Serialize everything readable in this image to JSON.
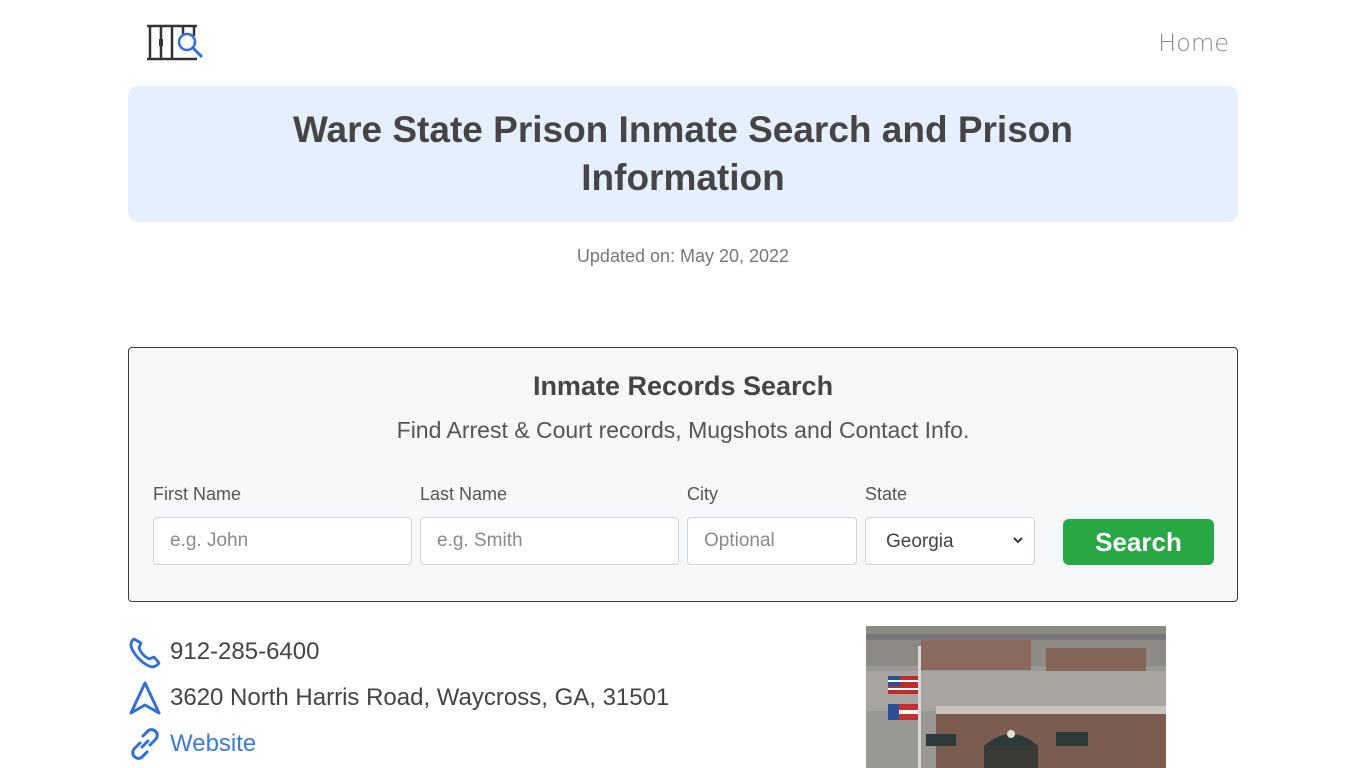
{
  "header": {
    "logo_icon": "jail-bars-search-icon",
    "nav_home": "Home"
  },
  "hero": {
    "title": "Ware State Prison Inmate Search and Prison Information"
  },
  "updated": "Updated on: May 20, 2022",
  "search": {
    "title": "Inmate Records Search",
    "subtitle": "Find Arrest & Court records, Mugshots and Contact Info.",
    "first_name_label": "First Name",
    "first_name_placeholder": "e.g. John",
    "last_name_label": "Last Name",
    "last_name_placeholder": "e.g. Smith",
    "city_label": "City",
    "city_placeholder": "Optional",
    "state_label": "State",
    "state_value": "Georgia",
    "button_label": "Search",
    "button_color": "#27a844"
  },
  "contact": {
    "phone": "912-285-6400",
    "address": "3620 North Harris Road, Waycross, GA, 31501",
    "website_label": "Website",
    "icon_color": "#2f6fdc"
  },
  "photo": {
    "subject": "prison-building-photo"
  }
}
